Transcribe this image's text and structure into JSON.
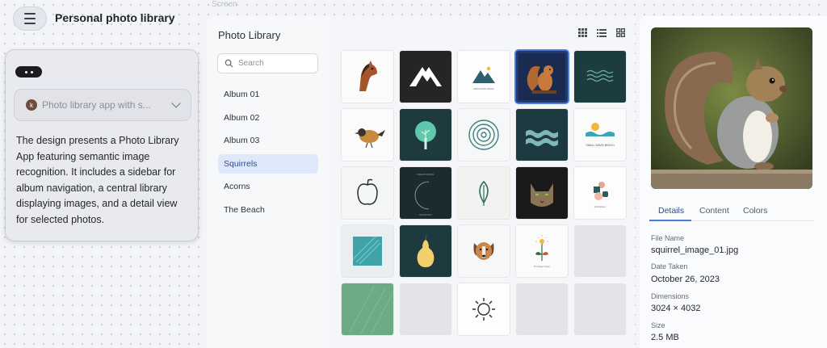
{
  "header": {
    "title": "Personal photo library",
    "menu_icon": "hamburger-menu-icon",
    "screen_label": "Screen"
  },
  "prompt_card": {
    "avatar_letter": "k",
    "prompt_text": "Photo library app with s...",
    "description": "The design presents a Photo Library App featuring semantic image recognition. It includes a sidebar for album navigation, a central library displaying images, and a detail view for selected photos."
  },
  "sidebar": {
    "title": "Photo Library",
    "search_placeholder": "Search",
    "albums": [
      {
        "label": "Album 01",
        "active": false
      },
      {
        "label": "Album 02",
        "active": false
      },
      {
        "label": "Album 03",
        "active": false
      },
      {
        "label": "Squirrels",
        "active": true
      },
      {
        "label": "Acorns",
        "active": false
      },
      {
        "label": "The Beach",
        "active": false
      }
    ]
  },
  "library": {
    "view_icons": [
      "grid-small-icon",
      "list-view-icon",
      "grid-large-icon"
    ],
    "thumbnails": [
      [
        "horse-icon",
        "mountain-dark-icon",
        "mountain-logo-icon",
        "squirrel-photo",
        "waves-dark-icon"
      ],
      [
        "bird-icon",
        "tree-icon",
        "spiral-icon",
        "waves-teal-icon",
        "beach-logo-icon"
      ],
      [
        "apple-icon",
        "moon-arc-icon",
        "leaf-icon",
        "cat-photo",
        "abstract-shapes-icon"
      ],
      [
        "teal-texture",
        "pear-icon",
        "dog-icon",
        "flower-icon",
        "placeholder"
      ],
      [
        "green-texture",
        "placeholder",
        "sun-icon",
        "placeholder",
        "placeholder"
      ]
    ],
    "thumbnail_text": {
      "mountain_logo": "MOUNTAIN WAVE",
      "beach_logo": "SMALL WAVE/ BEACH",
      "moon_arc_top": "DREAM MORE",
      "moon_arc_bottom": "MOONLIGHT",
      "abstract_shapes": "abstraction",
      "flower": "The Daisy Flower"
    },
    "selected": "squirrel-photo"
  },
  "detail": {
    "tabs": [
      "Details",
      "Content",
      "Colors"
    ],
    "active_tab": "Details",
    "fields": [
      {
        "label": "File Name",
        "value": "squirrel_image_01.jpg"
      },
      {
        "label": "Date Taken",
        "value": "October 26, 2023"
      },
      {
        "label": "Dimensions",
        "value": "3024 × 4032"
      },
      {
        "label": "Size",
        "value": "2.5 MB"
      }
    ]
  },
  "colors": {
    "accent": "#4c7bd9",
    "active_album_bg": "#dfe8fb",
    "dark_tile": "#1f2a2f",
    "teal_tile": "#1d3c40"
  }
}
